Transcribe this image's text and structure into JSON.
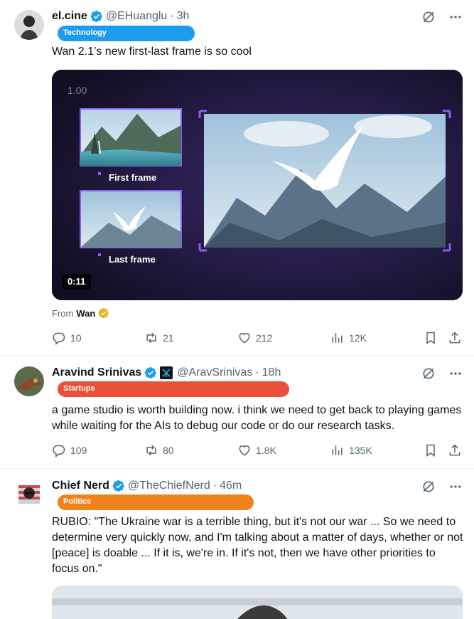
{
  "tweets": [
    {
      "name": "el.cine",
      "handle": "@EHuanglu",
      "time": "3h",
      "badge": "Technology",
      "badge_color": "#1d9bf0",
      "text": "Wan 2.1’s new first-last frame is so cool",
      "video": {
        "speed": "1.00",
        "first_label": "First frame",
        "last_label": "Last frame",
        "duration": "0:11"
      },
      "from_label": "From",
      "from_name": "Wan",
      "replies": "10",
      "reposts": "21",
      "likes": "212",
      "views": "12K"
    },
    {
      "name": "Aravind Srinivas",
      "handle": "@AravSrinivas",
      "time": "18h",
      "badge": "Startups",
      "badge_color": "#e8503a",
      "text": "a game studio is worth building now. i think we need to get back to playing games while waiting for the AIs to debug our code or do our research tasks.",
      "replies": "109",
      "reposts": "80",
      "likes": "1.8K",
      "views": "135K"
    },
    {
      "name": "Chief Nerd",
      "handle": "@TheChiefNerd",
      "time": "46m",
      "badge": "Politics",
      "badge_color": "#f0821e",
      "text": "RUBIO: \"The Ukraine war is a terrible thing, but it's not our war ... So we need to determine very quickly now, and I'm talking about a matter of days, whether or not [peace] is doable ... If it is, we're in. If it's not, then we have other priorities to focus on.\""
    }
  ],
  "separator": "·",
  "colors": {
    "verified": "#1d9bf0",
    "gold_verified": "#e2b719",
    "text_secondary": "#536471"
  }
}
